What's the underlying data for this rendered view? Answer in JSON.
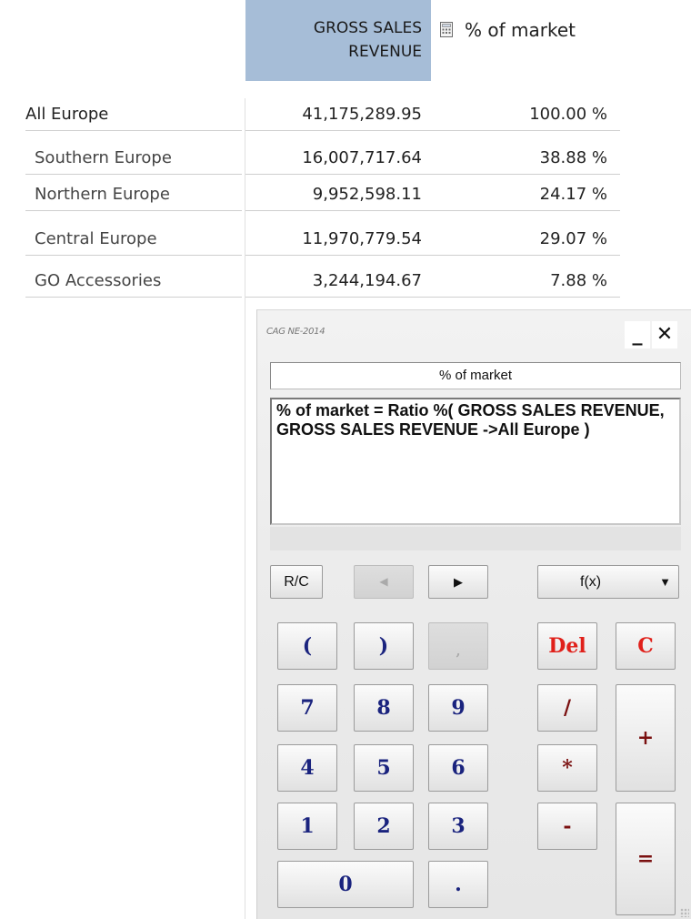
{
  "crosstab": {
    "header_gross_line1": "GROSS SALES",
    "header_gross_line2": "REVENUE",
    "header_pct": "% of market",
    "rows": [
      {
        "label": "All Europe",
        "gross": "41,175,289.95",
        "pct": "100.00 %"
      },
      {
        "label": "Southern Europe",
        "gross": "16,007,717.64",
        "pct": "38.88 %"
      },
      {
        "label": "Northern Europe",
        "gross": "9,952,598.11",
        "pct": "24.17 %"
      },
      {
        "label": "Central Europe",
        "gross": "11,970,779.54",
        "pct": "29.07 %"
      },
      {
        "label": "GO Accessories",
        "gross": "3,244,194.67",
        "pct": "7.88 %"
      }
    ]
  },
  "calculator": {
    "title": "CAG NE-2014",
    "minimize": "_",
    "close": "✕",
    "name_value": "% of market",
    "formula": "% of market = Ratio %( GROSS SALES REVENUE, GROSS SALES REVENUE ->All Europe )",
    "keys": {
      "rc": "R/C",
      "prev": "◀",
      "next": "▶",
      "fx": "f(x)",
      "fx_caret": "▼",
      "open_paren": "(",
      "close_paren": ")",
      "comma": ",",
      "del": "Del",
      "clear": "C",
      "seven": "7",
      "eight": "8",
      "nine": "9",
      "four": "4",
      "five": "5",
      "six": "6",
      "one": "1",
      "two": "2",
      "three": "3",
      "zero": "0",
      "dot": ".",
      "divide": "/",
      "multiply": "*",
      "minus": "-",
      "plus": "+",
      "equals": "="
    }
  }
}
